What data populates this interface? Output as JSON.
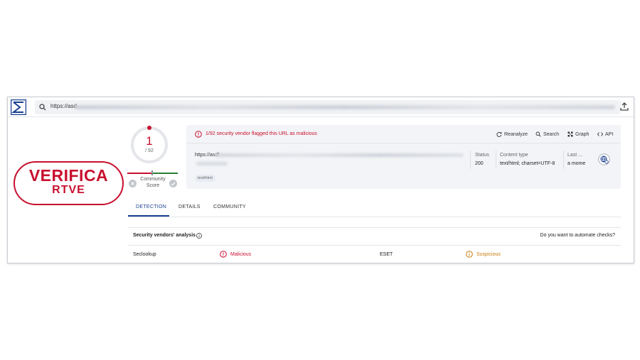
{
  "browser": {
    "url_visible": "https://asd",
    "upload_icon": "upload-icon"
  },
  "brand": {
    "line1": "VERIFICA",
    "line2": "RTVE",
    "color": "#c8102e"
  },
  "score": {
    "detections": "1",
    "total": "/ 92",
    "community_label_line1": "Community",
    "community_label_line2": "Score"
  },
  "summary": {
    "alert": "1/92 security vendor flagged this URL as malicious",
    "actions": {
      "reanalyze": "Reanalyze",
      "search": "Search",
      "graph": "Graph",
      "api": "API"
    },
    "url_label": "https://asdf",
    "tag": "text/html",
    "status_header": "Status",
    "status_value": "200",
    "content_type_header": "Content type",
    "content_type_value": "text/html; charset=UTF-8",
    "last_header": "Last ...",
    "last_value": "a mome"
  },
  "tabs": [
    {
      "label": "DETECTION",
      "active": true
    },
    {
      "label": "DETAILS",
      "active": false
    },
    {
      "label": "COMMUNITY",
      "active": false
    }
  ],
  "vendors": {
    "title": "Security vendors' analysis",
    "automate": "Do you want to automate checks?",
    "rows": [
      {
        "vendor1": "Seclookup",
        "result1": "Malicious",
        "vendor2": "ESET",
        "result2": "Suspicious"
      }
    ]
  },
  "colors": {
    "malicious": "#c8102e",
    "suspicious": "#c77c0e",
    "accent": "#1a3f8f"
  }
}
